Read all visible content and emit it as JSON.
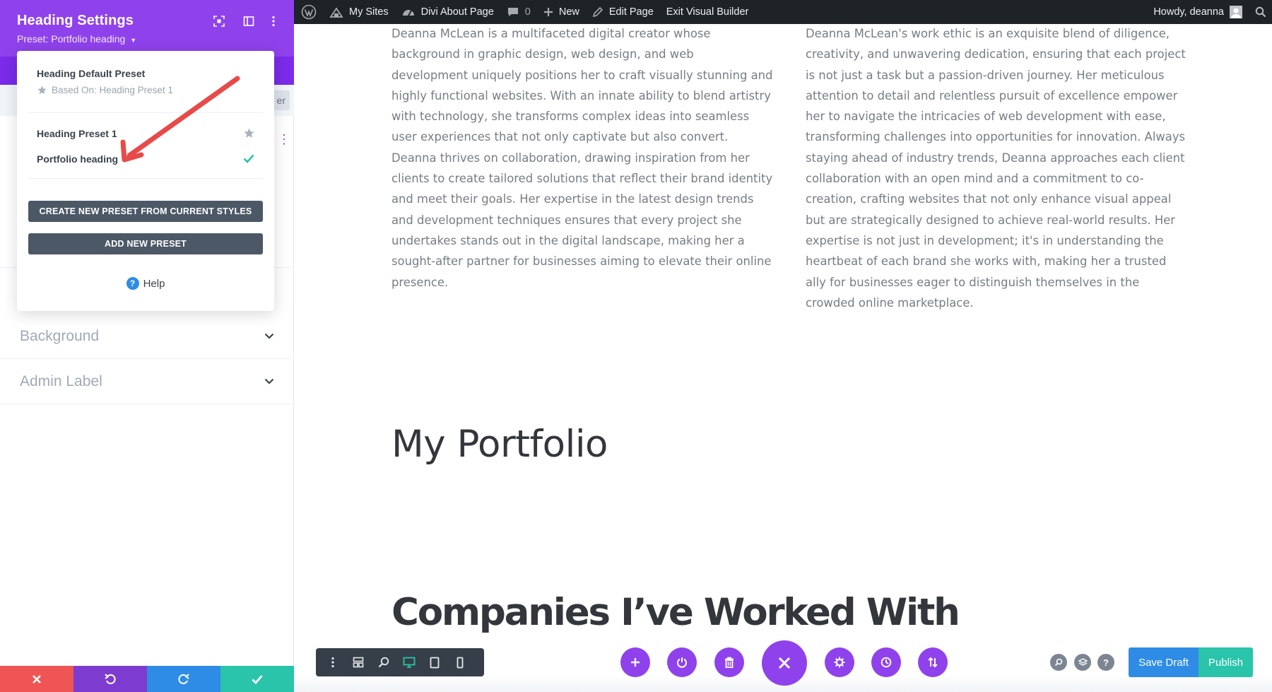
{
  "admin_bar": {
    "my_sites": "My Sites",
    "site_name": "Divi About Page",
    "comments_count": "0",
    "new_label": "New",
    "edit_page": "Edit Page",
    "exit_builder": "Exit Visual Builder",
    "howdy": "Howdy, deanna"
  },
  "panel": {
    "title": "Heading Settings",
    "preset_label": "Preset: Portfolio heading",
    "filter_fragment": "er",
    "toggles": [
      {
        "label": "Background"
      },
      {
        "label": "Admin Label"
      }
    ],
    "accent_color": "#8f42ec"
  },
  "preset_dropdown": {
    "default_preset": "Heading Default Preset",
    "based_on": "Based On: Heading Preset 1",
    "presets": [
      {
        "label": "Heading Preset 1",
        "icon": "star-icon"
      },
      {
        "label": "Portfolio heading",
        "icon": "check-icon",
        "active": true
      }
    ],
    "create_button": "CREATE NEW PRESET FROM CURRENT STYLES",
    "add_button": "ADD NEW PRESET",
    "help": "Help"
  },
  "content": {
    "column_left": "Deanna McLean is a multifaceted digital creator whose background in graphic design, web design, and web development uniquely positions her to craft visually stunning and highly functional websites. With an innate ability to blend artistry with technology, she transforms complex ideas into seamless user experiences that not only captivate but also convert. Deanna thrives on collaboration, drawing inspiration from her clients to create tailored solutions that reflect their brand identity and meet their goals. Her expertise in the latest design trends and development techniques ensures that every project she undertakes stands out in the digital landscape, making her a sought-after partner for businesses aiming to elevate their online presence.",
    "column_right": "Deanna McLean's work ethic is an exquisite blend of diligence, creativity, and unwavering dedication, ensuring that each project is not just a task but a passion-driven journey. Her meticulous attention to detail and relentless pursuit of excellence empower her to navigate the intricacies of web development with ease, transforming challenges into opportunities for innovation. Always staying ahead of industry trends, Deanna approaches each client collaboration with an open mind and a commitment to co-creation, crafting websites that not only enhance visual appeal but are strategically designed to achieve real-world results. Her expertise is not just in development; it's in understanding the heartbeat of each brand she works with, making her a trusted ally for businesses eager to distinguish themselves in the crowded online marketplace.",
    "heading_portfolio": "My Portfolio",
    "heading_companies": "Companies I’ve Worked With"
  },
  "builder_bar": {
    "save_draft": "Save Draft",
    "publish": "Publish",
    "view_buttons": [
      "kebab-icon",
      "layout-icon",
      "zoom-icon",
      "desktop-icon",
      "tablet-icon",
      "phone-icon"
    ],
    "actions": [
      "add-icon",
      "power-icon",
      "trash-icon",
      "close-icon",
      "gear-icon",
      "history-icon",
      "sort-icon"
    ]
  },
  "colors": {
    "discard": "#ef5555",
    "undo": "#7e3bd0",
    "redo": "#2e8ce6",
    "save": "#29c4a9",
    "annotation_arrow": "#e84a4a"
  }
}
